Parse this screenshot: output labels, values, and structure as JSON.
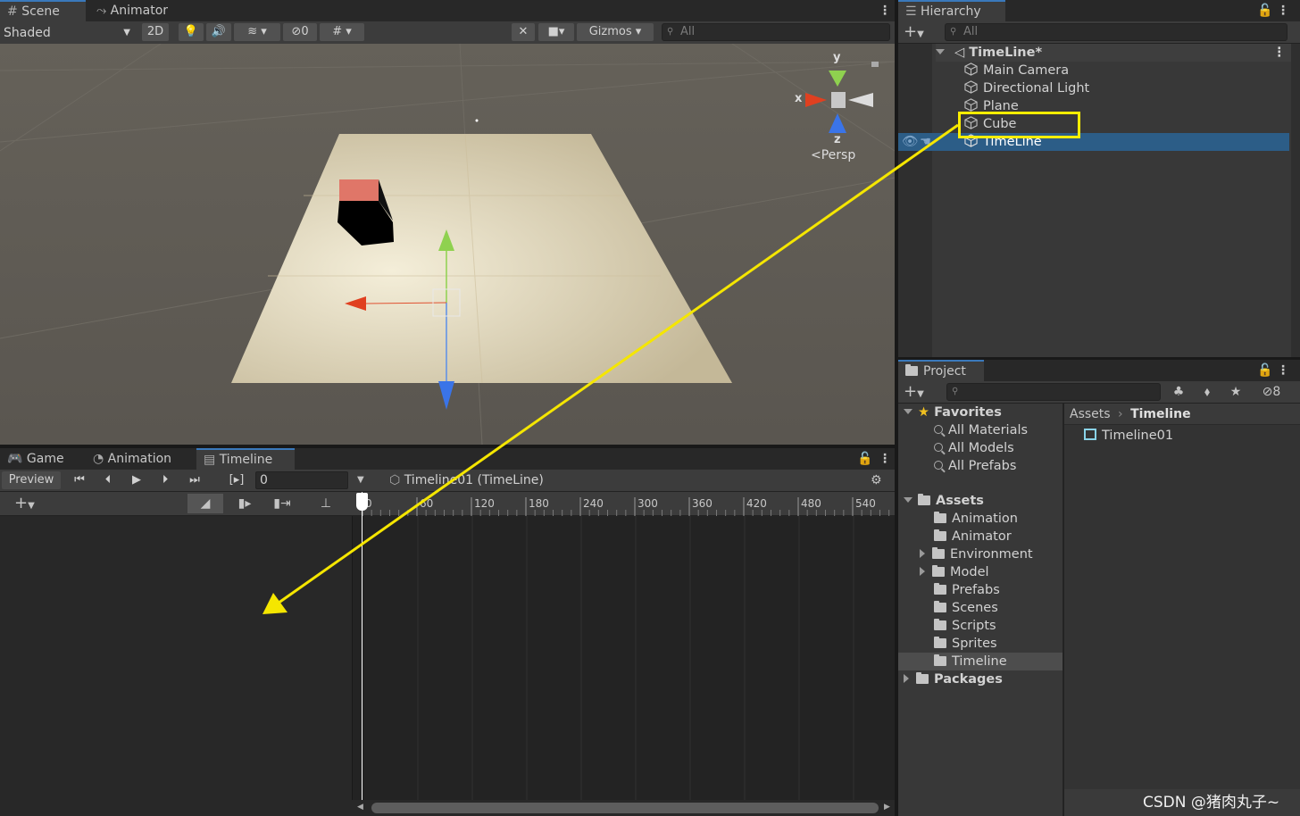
{
  "scene_panel": {
    "tabs": [
      {
        "label": "Scene",
        "icon": "grid-icon"
      },
      {
        "label": "Animator",
        "icon": "animator-icon"
      }
    ],
    "toolbar": {
      "shading_mode": "Shaded",
      "mode_2d": "2D",
      "hidden_count": "0",
      "gizmos_label": "Gizmos",
      "search_placeholder": "All"
    },
    "gizmo_labels": {
      "y": "y",
      "x": "x",
      "z": "z",
      "persp": "Persp"
    }
  },
  "hierarchy": {
    "tab_label": "Hierarchy",
    "search_placeholder": "All",
    "root": "TimeLine*",
    "items": [
      "Main Camera",
      "Directional Light",
      "Plane",
      "Cube",
      "TimeLine"
    ],
    "highlighted": "Cube",
    "selected": "TimeLine"
  },
  "timeline_panel": {
    "tabs": [
      {
        "label": "Game",
        "icon": "gamepad-icon"
      },
      {
        "label": "Animation",
        "icon": "clock-icon"
      },
      {
        "label": "Timeline",
        "icon": "film-icon"
      }
    ],
    "preview_label": "Preview",
    "frame_value": "0",
    "asset_label": "Timeline01 (TimeLine)",
    "ruler_ticks": [
      "0",
      "60",
      "120",
      "180",
      "240",
      "300",
      "360",
      "420",
      "480",
      "540"
    ]
  },
  "project": {
    "tab_label": "Project",
    "hidden_count": "8",
    "favorites_label": "Favorites",
    "favorites": [
      "All Materials",
      "All Models",
      "All Prefabs"
    ],
    "assets_label": "Assets",
    "folders": [
      {
        "name": "Animation",
        "expandable": false
      },
      {
        "name": "Animator",
        "expandable": false
      },
      {
        "name": "Environment",
        "expandable": true
      },
      {
        "name": "Model",
        "expandable": true
      },
      {
        "name": "Prefabs",
        "expandable": false
      },
      {
        "name": "Scenes",
        "expandable": false
      },
      {
        "name": "Scripts",
        "expandable": false
      },
      {
        "name": "Sprites",
        "expandable": false
      },
      {
        "name": "Timeline",
        "expandable": false
      }
    ],
    "selected_folder": "Timeline",
    "packages_label": "Packages",
    "breadcrumb": [
      "Assets",
      "Timeline"
    ],
    "files": [
      "Timeline01"
    ]
  },
  "watermark": "CSDN @猪肉丸子~",
  "colors": {
    "highlight_box": "#ffee00",
    "annotation_arrow": "#f5e600",
    "selection": "#2c5d87",
    "accent_tab": "#3a79bb"
  }
}
